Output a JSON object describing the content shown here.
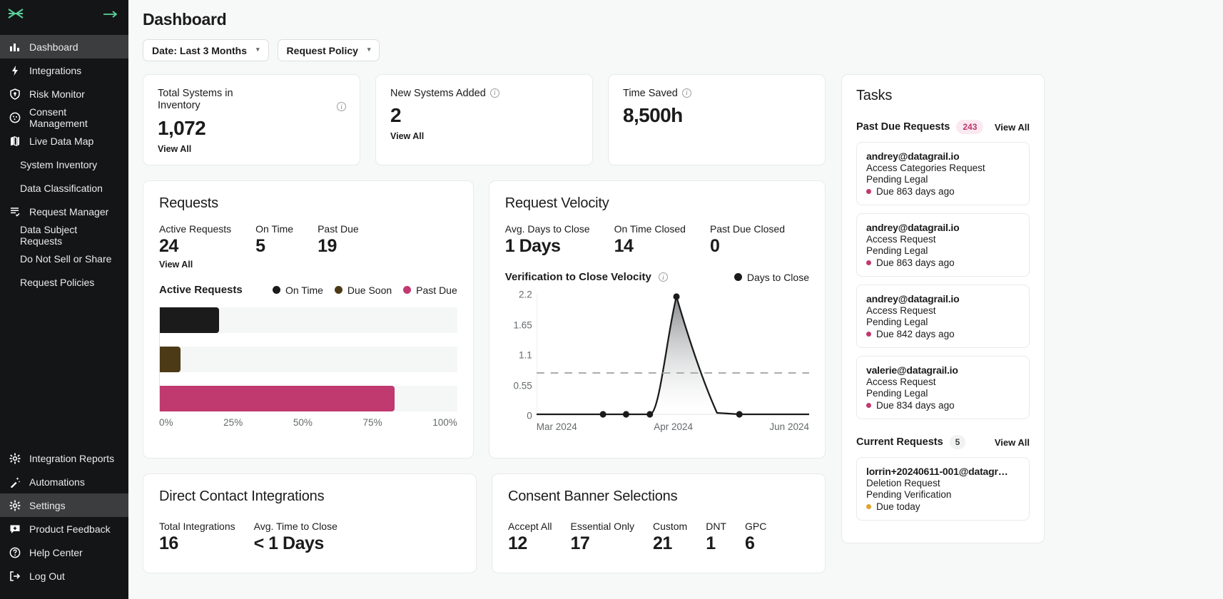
{
  "brand": {
    "logo_icon": "datagrail-logo",
    "collapse_icon": "arrow-right-icon"
  },
  "sidebar": {
    "items": [
      {
        "label": "Dashboard",
        "icon": "bar-chart-icon",
        "active": true,
        "sub": false
      },
      {
        "label": "Integrations",
        "icon": "lightning-icon",
        "active": false,
        "sub": false
      },
      {
        "label": "Risk Monitor",
        "icon": "shield-icon",
        "active": false,
        "sub": false
      },
      {
        "label": "Consent Management",
        "icon": "cookie-icon",
        "active": false,
        "sub": false
      },
      {
        "label": "Live Data Map",
        "icon": "map-icon",
        "active": false,
        "sub": false
      },
      {
        "label": "System Inventory",
        "icon": "",
        "active": false,
        "sub": true
      },
      {
        "label": "Data Classification",
        "icon": "",
        "active": false,
        "sub": true
      },
      {
        "label": "Request Manager",
        "icon": "list-check-icon",
        "active": false,
        "sub": false
      },
      {
        "label": "Data Subject Requests",
        "icon": "",
        "active": false,
        "sub": true
      },
      {
        "label": "Do Not Sell or Share",
        "icon": "",
        "active": false,
        "sub": true
      },
      {
        "label": "Request Policies",
        "icon": "",
        "active": false,
        "sub": true
      }
    ],
    "bottom_items": [
      {
        "label": "Integration Reports",
        "icon": "gear-icon",
        "active": false
      },
      {
        "label": "Automations",
        "icon": "magic-wand-icon",
        "active": false
      },
      {
        "label": "Settings",
        "icon": "gear-icon",
        "active": true
      },
      {
        "label": "Product Feedback",
        "icon": "feedback-icon",
        "active": false
      },
      {
        "label": "Help Center",
        "icon": "question-circle-icon",
        "active": false
      },
      {
        "label": "Log Out",
        "icon": "logout-icon",
        "active": false
      }
    ]
  },
  "header": {
    "title": "Dashboard",
    "filters": [
      {
        "label": "Date: Last 3 Months",
        "icon": "chevron-down-icon"
      },
      {
        "label": "Request Policy",
        "icon": "chevron-down-icon"
      }
    ]
  },
  "stats": [
    {
      "label": "Total Systems in Inventory",
      "value": "1,072",
      "link": "View All",
      "info": true
    },
    {
      "label": "New Systems Added",
      "value": "2",
      "link": "View All",
      "info": true
    },
    {
      "label": "Time Saved",
      "value": "8,500h",
      "link": "",
      "info": true
    }
  ],
  "requests_panel": {
    "title": "Requests",
    "kpis": [
      {
        "label": "Active Requests",
        "value": "24",
        "link": "View All"
      },
      {
        "label": "On Time",
        "value": "5",
        "link": ""
      },
      {
        "label": "Past Due",
        "value": "19",
        "link": ""
      }
    ],
    "chart_title": "Active Requests",
    "legend": [
      {
        "label": "On Time",
        "color": "#1b1b1b"
      },
      {
        "label": "Due Soon",
        "color": "#4c3a16"
      },
      {
        "label": "Past Due",
        "color": "#c0396f"
      }
    ]
  },
  "velocity_panel": {
    "title": "Request Velocity",
    "kpis": [
      {
        "label": "Avg. Days to Close",
        "value": "1 Days"
      },
      {
        "label": "On Time Closed",
        "value": "14"
      },
      {
        "label": "Past Due Closed",
        "value": "0"
      }
    ],
    "chart_title": "Verification to Close Velocity",
    "legend": [
      {
        "label": "Days to Close",
        "color": "#1b1b1b"
      }
    ]
  },
  "tasks": {
    "title": "Tasks",
    "sections": [
      {
        "label": "Past Due Requests",
        "count": "243",
        "count_style": "pink",
        "view_all": "View All",
        "cards": [
          {
            "email": "andrey@datagrail.io",
            "type": "Access Categories Request",
            "status": "Pending Legal",
            "due": "Due 863 days ago",
            "due_color": "#c0396f"
          },
          {
            "email": "andrey@datagrail.io",
            "type": "Access Request",
            "status": "Pending Legal",
            "due": "Due 863 days ago",
            "due_color": "#c0396f"
          },
          {
            "email": "andrey@datagrail.io",
            "type": "Access Request",
            "status": "Pending Legal",
            "due": "Due 842 days ago",
            "due_color": "#c0396f"
          },
          {
            "email": "valerie@datagrail.io",
            "type": "Access Request",
            "status": "Pending Legal",
            "due": "Due 834 days ago",
            "due_color": "#c0396f"
          }
        ]
      },
      {
        "label": "Current Requests",
        "count": "5",
        "count_style": "grey",
        "view_all": "View All",
        "cards": [
          {
            "email": "lorrin+20240611-001@datagr…",
            "type": "Deletion Request",
            "status": "Pending Verification",
            "due": "Due today",
            "due_color": "#e0a32e"
          }
        ]
      }
    ]
  },
  "bottom_panels": [
    {
      "title": "Direct Contact Integrations",
      "kpis": [
        {
          "label": "Total Integrations",
          "value": "16"
        },
        {
          "label": "Avg. Time to Close",
          "value": "< 1 Days"
        }
      ]
    },
    {
      "title": "Consent Banner Selections",
      "kpis": [
        {
          "label": "Accept All",
          "value": "12"
        },
        {
          "label": "Essential Only",
          "value": "17"
        },
        {
          "label": "Custom",
          "value": "21"
        },
        {
          "label": "DNT",
          "value": "1"
        },
        {
          "label": "GPC",
          "value": "6"
        }
      ]
    }
  ],
  "chart_data": [
    {
      "type": "bar",
      "title": "Active Requests",
      "orientation": "horizontal",
      "categories": [
        "On Time",
        "Due Soon",
        "Past Due"
      ],
      "values": [
        20,
        7,
        79
      ],
      "colors": [
        "#1b1b1b",
        "#4c3a16",
        "#c0396f"
      ],
      "xlabel": "",
      "ylabel": "",
      "xlim": [
        0,
        100
      ],
      "xticks": [
        "0%",
        "25%",
        "50%",
        "75%",
        "100%"
      ],
      "grid": false,
      "legend_position": "top-right"
    },
    {
      "type": "line",
      "title": "Verification to Close Velocity",
      "series": [
        {
          "name": "Days to Close",
          "x": [
            "Mar 2024",
            "",
            "Apr 2024",
            "",
            "",
            "Jun 2024"
          ],
          "values": [
            0,
            0,
            0,
            2.2,
            0,
            0
          ]
        }
      ],
      "x": [
        "Mar 2024",
        "Apr 2024",
        "Jun 2024"
      ],
      "ylabel": "",
      "xlabel": "",
      "ylim": [
        0,
        2.2
      ],
      "yticks": [
        "2.2",
        "1.65",
        "1.1",
        "0.55",
        "0"
      ],
      "average_line": 0.95,
      "area_fill": true,
      "grid": false,
      "legend_position": "top-right"
    }
  ]
}
